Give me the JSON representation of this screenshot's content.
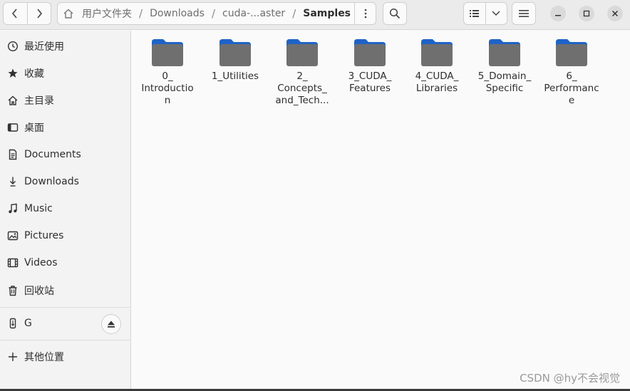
{
  "header": {
    "breadcrumbs": [
      "用户文件夹",
      "Downloads",
      "cuda-...aster",
      "Samples"
    ],
    "separator": "/"
  },
  "sidebar": {
    "items": [
      {
        "label": "最近使用",
        "icon": "clock-icon"
      },
      {
        "label": "收藏",
        "icon": "star-icon"
      },
      {
        "label": "主目录",
        "icon": "home-icon"
      },
      {
        "label": "桌面",
        "icon": "desktop-icon"
      },
      {
        "label": "Documents",
        "icon": "document-icon"
      },
      {
        "label": "Downloads",
        "icon": "download-icon"
      },
      {
        "label": "Music",
        "icon": "music-icon"
      },
      {
        "label": "Pictures",
        "icon": "picture-icon"
      },
      {
        "label": "Videos",
        "icon": "video-icon"
      },
      {
        "label": "回收站",
        "icon": "trash-icon"
      }
    ],
    "drive": {
      "label": "G",
      "icon": "usb-drive-icon"
    },
    "other": {
      "label": "其他位置",
      "icon": "plus-icon"
    }
  },
  "folders": [
    {
      "name": "0_\nIntroductio\nn"
    },
    {
      "name": "1_Utilities"
    },
    {
      "name": "2_\nConcepts_\nand_Tech..."
    },
    {
      "name": "3_CUDA_\nFeatures"
    },
    {
      "name": "4_CUDA_\nLibraries"
    },
    {
      "name": "5_Domain_\nSpecific"
    },
    {
      "name": "6_\nPerformanc\ne"
    }
  ],
  "watermark": "CSDN @hy不会视觉",
  "colors": {
    "folder_body": "#6f6f6f",
    "folder_tab": "#1f63c7",
    "accent": "#3584e4"
  }
}
